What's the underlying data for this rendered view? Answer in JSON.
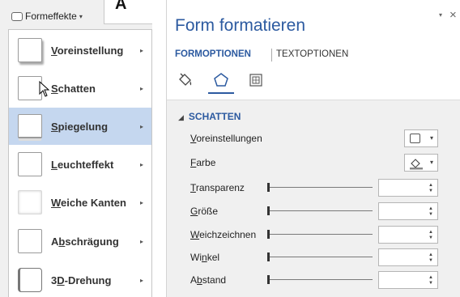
{
  "ribbon": {
    "button_label": "Formeffekte",
    "caret": "▾",
    "next_glyph": "A"
  },
  "menu": {
    "items": [
      {
        "label_pre": "",
        "label_u": "V",
        "label_post": "oreinstellung",
        "arrow": "▸"
      },
      {
        "label_pre": "",
        "label_u": "S",
        "label_post": "chatten",
        "arrow": "▸"
      },
      {
        "label_pre": "",
        "label_u": "S",
        "label_post": "piegelung",
        "arrow": "▸"
      },
      {
        "label_pre": "",
        "label_u": "L",
        "label_post": "euchteffekt",
        "arrow": "▸"
      },
      {
        "label_pre": "",
        "label_u": "W",
        "label_post": "eiche Kanten",
        "arrow": "▸"
      },
      {
        "label_pre": "A",
        "label_u": "b",
        "label_post": "schrägung",
        "arrow": "▸"
      },
      {
        "label_pre": "3",
        "label_u": "D",
        "label_post": "-Drehung",
        "arrow": "▸"
      }
    ],
    "highlighted_index": 2
  },
  "panel": {
    "title": "Form formatieren",
    "dropdown_glyph": "▾",
    "close_glyph": "×",
    "tabs": {
      "active": "FORMOPTIONEN",
      "inactive": "TEXTOPTIONEN"
    },
    "icons": [
      "fill-line-icon",
      "effects-icon",
      "size-properties-icon"
    ],
    "section": {
      "title": "SCHATTEN",
      "toggle": "◢",
      "rows": [
        {
          "pre": "",
          "u": "V",
          "post": "oreinstellungen",
          "control": "preset-picker"
        },
        {
          "pre": "",
          "u": "F",
          "post": "arbe",
          "control": "color-picker"
        },
        {
          "pre": "",
          "u": "T",
          "post": "ransparenz",
          "control": "slider",
          "value": ""
        },
        {
          "pre": "",
          "u": "G",
          "post": "röße",
          "control": "slider",
          "value": ""
        },
        {
          "pre": "",
          "u": "W",
          "post": "eichzeichnen",
          "control": "slider",
          "value": ""
        },
        {
          "pre": "Wi",
          "u": "n",
          "post": "kel",
          "control": "slider",
          "value": ""
        },
        {
          "pre": "A",
          "u": "b",
          "post": "stand",
          "control": "slider",
          "value": ""
        }
      ]
    },
    "accent_color": "#2c5aa0",
    "highlight_color": "#c5d7ef"
  }
}
